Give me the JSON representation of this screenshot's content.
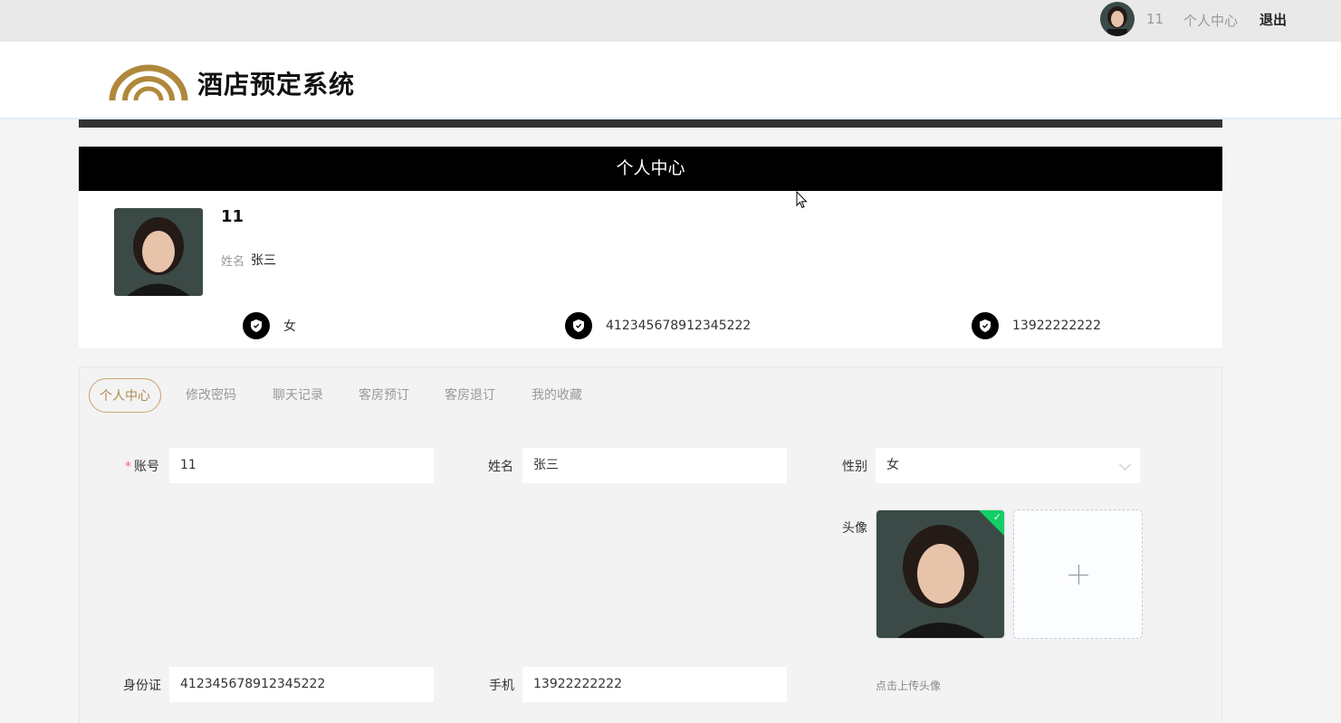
{
  "topbar": {
    "username": "11",
    "user_center": "个人中心",
    "logout": "退出",
    "avatar_icon": "user-avatar"
  },
  "header": {
    "site_title": "酒店预定系统",
    "brand_color": "#b0883c"
  },
  "banner": {
    "title": "个人中心"
  },
  "profile": {
    "username": "11",
    "realname_label": "姓名",
    "realname": "张三",
    "gender": "女",
    "id_number": "412345678912345222",
    "phone": "13922222222",
    "info_icon": "shield-icon"
  },
  "tabs": [
    {
      "label": "个人中心",
      "active": true
    },
    {
      "label": "修改密码",
      "active": false
    },
    {
      "label": "聊天记录",
      "active": false
    },
    {
      "label": "客房预订",
      "active": false
    },
    {
      "label": "客房退订",
      "active": false
    },
    {
      "label": "我的收藏",
      "active": false
    }
  ],
  "form": {
    "account_label": "账号",
    "account_value": "11",
    "name_label": "姓名",
    "name_value": "张三",
    "gender_label": "性别",
    "gender_value": "女",
    "avatar_label": "头像",
    "idcard_label": "身份证",
    "idcard_value": "412345678912345222",
    "phone_label": "手机",
    "phone_value": "13922222222",
    "upload_tip": "点击上传头像"
  },
  "colors": {
    "accent": "#c9a46c",
    "banner_bg": "#000000",
    "required": "#f56c6c",
    "success": "#13ce66"
  }
}
